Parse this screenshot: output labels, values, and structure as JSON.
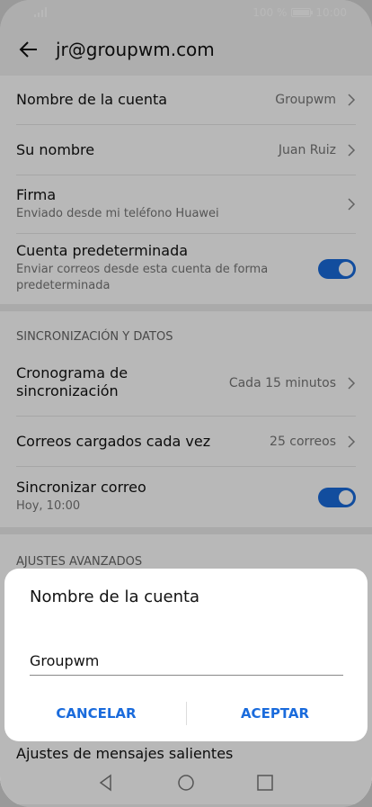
{
  "status": {
    "battery": "100 %",
    "time": "10:00"
  },
  "header": {
    "title": "jr@groupwm.com"
  },
  "account": {
    "name_label": "Nombre de la cuenta",
    "name_value": "Groupwm",
    "your_name_label": "Su nombre",
    "your_name_value": "Juan Ruiz",
    "signature_label": "Firma",
    "signature_value": "Enviado desde mi teléfono Huawei",
    "default_label": "Cuenta predeterminada",
    "default_desc": "Enviar correos desde esta cuenta de forma predeterminada"
  },
  "sync": {
    "section_title": "SINCRONIZACIÓN Y DATOS",
    "schedule_label": "Cronograma de sincronización",
    "schedule_value": "Cada 15 minutos",
    "load_label": "Correos cargados cada vez",
    "load_value": "25 correos",
    "sync_label": "Sincronizar correo",
    "sync_desc": "Hoy, 10:00"
  },
  "advanced": {
    "section_title": "AJUSTES AVANZADOS",
    "outgoing_label": "Ajustes de mensajes salientes"
  },
  "dialog": {
    "title": "Nombre de la cuenta",
    "input_value": "Groupwm",
    "cancel": "CANCELAR",
    "accept": "ACEPTAR"
  },
  "colors": {
    "accent": "#1a6bdc",
    "background": "#f2f2f2",
    "dialog": "#ffffff"
  }
}
